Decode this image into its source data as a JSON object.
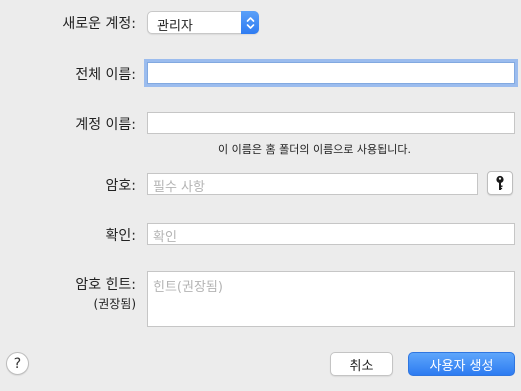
{
  "account_type": {
    "label": "새로운 계정:",
    "selected": "관리자"
  },
  "full_name": {
    "label": "전체 이름:",
    "value": ""
  },
  "account_name": {
    "label": "계정 이름:",
    "value": "",
    "hint": "이 이름은 홈 폴더의 이름으로 사용됩니다."
  },
  "password": {
    "label": "암호:",
    "placeholder": "필수 사항",
    "assistant_icon": "key-icon"
  },
  "verify": {
    "label": "확인:",
    "placeholder": "확인"
  },
  "password_hint": {
    "label": "암호 힌트:",
    "sublabel": "(권장됨)",
    "placeholder": "힌트(권장됨)"
  },
  "buttons": {
    "help": "?",
    "cancel": "취소",
    "create": "사용자 생성"
  },
  "colors": {
    "accent": "#2f7cf2",
    "background": "#ececec"
  }
}
